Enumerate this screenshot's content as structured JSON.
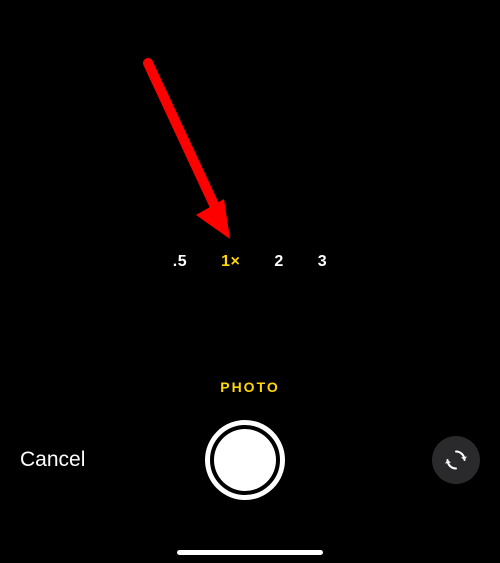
{
  "zoom": {
    "options": [
      {
        "label": ".5",
        "active": false
      },
      {
        "label": "1×",
        "active": true
      },
      {
        "label": "2",
        "active": false
      },
      {
        "label": "3",
        "active": false
      }
    ]
  },
  "mode": {
    "current": "PHOTO"
  },
  "controls": {
    "cancel_label": "Cancel"
  },
  "colors": {
    "accent": "#ffd60a",
    "annotation_arrow": "#ff0000"
  }
}
